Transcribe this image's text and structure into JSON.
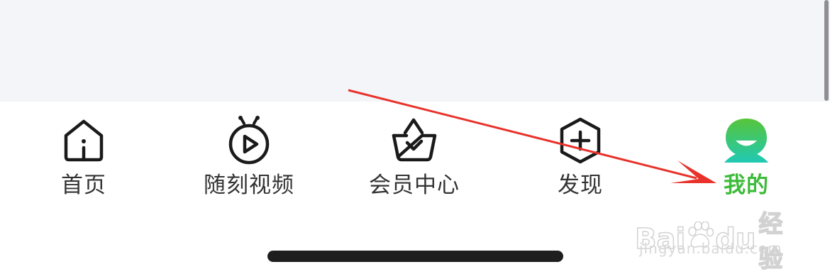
{
  "colors": {
    "active": "#3dbb3a",
    "inactive_text": "#333333",
    "icon_stroke": "#1a1a1a",
    "background_top": "#f4f5f9",
    "annotation_arrow": "#e8322b"
  },
  "tabs": [
    {
      "label": "首页",
      "icon": "home-icon",
      "active": false
    },
    {
      "label": "随刻视频",
      "icon": "play-circle-icon",
      "active": false
    },
    {
      "label": "会员中心",
      "icon": "vip-basket-icon",
      "active": false
    },
    {
      "label": "发现",
      "icon": "plus-hexagon-icon",
      "active": false
    },
    {
      "label": "我的",
      "icon": "profile-avatar-icon",
      "active": true
    }
  ],
  "watermark": {
    "brand_a": "Bai",
    "brand_b": "du",
    "brand_c": "经验",
    "url": "jingyan.baidu.com"
  }
}
